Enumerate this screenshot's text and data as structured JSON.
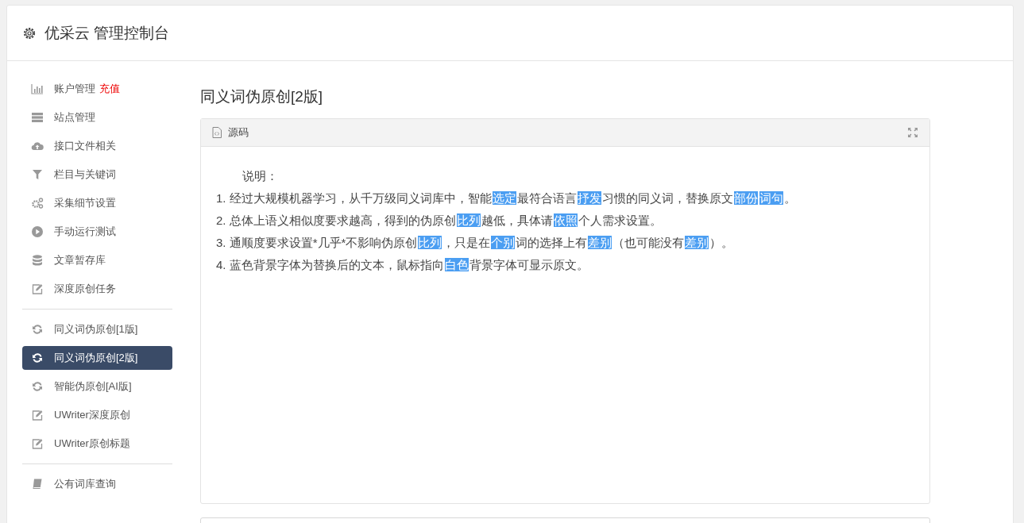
{
  "app": {
    "title": "优采云 管理控制台"
  },
  "sidebar": {
    "groups": [
      {
        "items": [
          {
            "label": "账户管理",
            "kind": "chart",
            "selected": false,
            "badge": "充值"
          },
          {
            "label": "站点管理",
            "kind": "server",
            "selected": false
          },
          {
            "label": "接口文件相关",
            "kind": "cloud",
            "selected": false
          },
          {
            "label": "栏目与关键词",
            "kind": "filter",
            "selected": false
          },
          {
            "label": "采集细节设置",
            "kind": "gears",
            "selected": false
          },
          {
            "label": "手动运行测试",
            "kind": "play",
            "selected": false
          },
          {
            "label": "文章暂存库",
            "kind": "database",
            "selected": false
          },
          {
            "label": "深度原创任务",
            "kind": "edit",
            "selected": false
          }
        ]
      },
      {
        "items": [
          {
            "label": "同义词伪原创[1版]",
            "kind": "refresh",
            "selected": false
          },
          {
            "label": "同义词伪原创[2版]",
            "kind": "refresh",
            "selected": true
          },
          {
            "label": "智能伪原创[AI版]",
            "kind": "refresh",
            "selected": false
          },
          {
            "label": "UWriter深度原创",
            "kind": "edit",
            "selected": false
          },
          {
            "label": "UWriter原创标题",
            "kind": "edit",
            "selected": false
          }
        ]
      },
      {
        "items": [
          {
            "label": "公有词库查询",
            "kind": "book",
            "selected": false
          }
        ]
      }
    ]
  },
  "page": {
    "title": "同义词伪原创[2版]"
  },
  "panel": {
    "title": "源码",
    "intro": "说明：",
    "notes": [
      {
        "number": "1.",
        "segments": [
          {
            "text": "经过大规模机器学习，从千万级同义词库中，智能",
            "replaced": false
          },
          {
            "text": "选定",
            "replaced": true
          },
          {
            "text": "最符合语言",
            "replaced": false
          },
          {
            "text": "抒发",
            "replaced": true
          },
          {
            "text": "习惯的同义词，替换原文",
            "replaced": false
          },
          {
            "text": "部份",
            "replaced": true
          },
          {
            "text": "词句",
            "replaced": true
          },
          {
            "text": "。",
            "replaced": false
          }
        ]
      },
      {
        "number": "2.",
        "segments": [
          {
            "text": "总体上语义相似度要求越高，得到的伪原创",
            "replaced": false
          },
          {
            "text": "比列",
            "replaced": true
          },
          {
            "text": "越低，具体请",
            "replaced": false
          },
          {
            "text": "依照",
            "replaced": true
          },
          {
            "text": "个人需求设置。",
            "replaced": false
          }
        ]
      },
      {
        "number": "3.",
        "segments": [
          {
            "text": "通顺度要求设置*几乎*不影响伪原创",
            "replaced": false
          },
          {
            "text": "比列",
            "replaced": true
          },
          {
            "text": "，只是在",
            "replaced": false
          },
          {
            "text": "个别",
            "replaced": true
          },
          {
            "text": "词的选择上有",
            "replaced": false
          },
          {
            "text": "差别",
            "replaced": true
          },
          {
            "text": "（也可能没有",
            "replaced": false
          },
          {
            "text": "差别",
            "replaced": true
          },
          {
            "text": "）。",
            "replaced": false
          }
        ]
      },
      {
        "number": "4.",
        "segments": [
          {
            "text": "蓝色背景字体为替换后的文本，鼠标指向",
            "replaced": false
          },
          {
            "text": "白色",
            "replaced": true
          },
          {
            "text": "背景字体可显示原文。",
            "replaced": false
          }
        ]
      }
    ]
  }
}
